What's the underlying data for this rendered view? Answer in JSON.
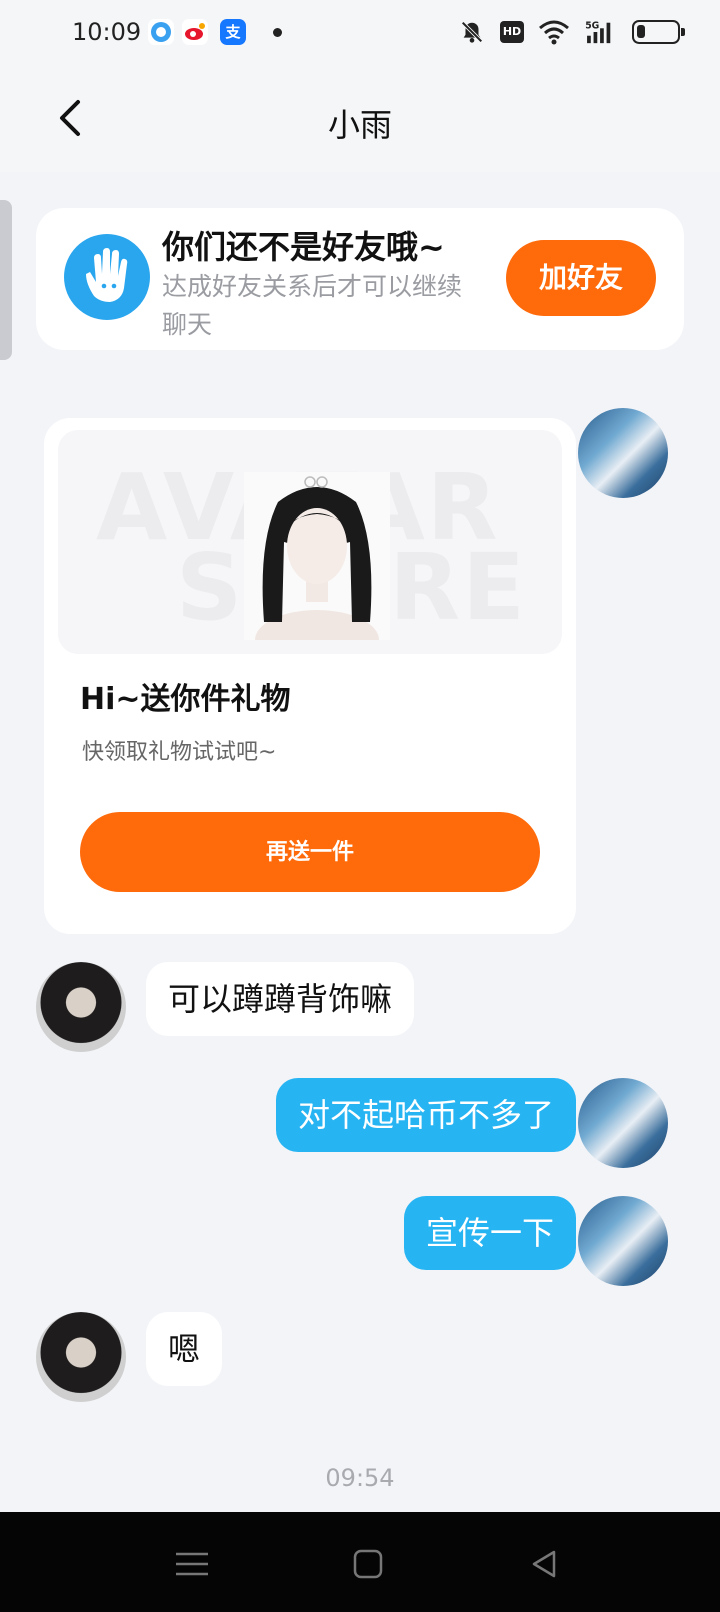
{
  "status_bar": {
    "time": "10:09",
    "app_icons": [
      "qq-browser-icon",
      "weibo-icon",
      "alipay-icon"
    ],
    "alipay_glyph": "支",
    "hd_badge": "HD",
    "signal_label": "5G",
    "battery_percent": 20
  },
  "nav": {
    "title": "小雨"
  },
  "friend_notice": {
    "title": "你们还不是好友哦~",
    "subtitle": "达成好友关系后才可以继续聊天",
    "button": "加好友",
    "accent": "#ff6a0a"
  },
  "gift_card": {
    "watermark_top": "AVATAR",
    "watermark_bottom": "STORE",
    "title": "Hi~送你件礼物",
    "subtitle": "快领取礼物试试吧~",
    "button": "再送一件"
  },
  "messages": [
    {
      "from": "other",
      "text": "可以蹲蹲背饰嘛"
    },
    {
      "from": "me",
      "text": "对不起哈币不多了"
    },
    {
      "from": "me",
      "text": "宣传一下"
    },
    {
      "from": "other",
      "text": "嗯"
    }
  ],
  "time_divider": "09:54",
  "colors": {
    "outgoing_bubble": "#27b4f3",
    "incoming_bubble": "#ffffff",
    "background": "#f2f4f8"
  }
}
